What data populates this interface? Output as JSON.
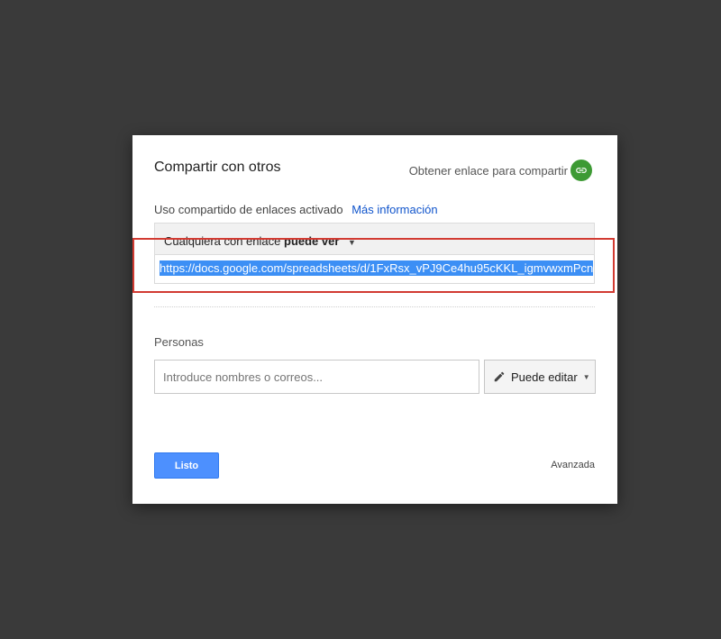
{
  "dialog": {
    "title": "Compartir con otros",
    "get_link_label": "Obtener enlace para compartir",
    "get_link_icon": "link-icon",
    "accent_color": "#3d9a34"
  },
  "link_sharing": {
    "status_text": "Uso compartido de enlaces activado",
    "more_info_label": "Más información",
    "permission_prefix": "Cualquiera con enlace",
    "permission_value": "puede ver",
    "url": "https://docs.google.com/spreadsheets/d/1FxRsx_vPJ9Ce4hu95cKKL_igmvwxmPcn"
  },
  "people": {
    "label": "Personas",
    "input_placeholder": "Introduce nombres o correos...",
    "permission_label": "Puede editar",
    "permission_icon": "pencil-icon"
  },
  "footer": {
    "done_label": "Listo",
    "advanced_label": "Avanzada",
    "done_color": "#4d90fe"
  }
}
